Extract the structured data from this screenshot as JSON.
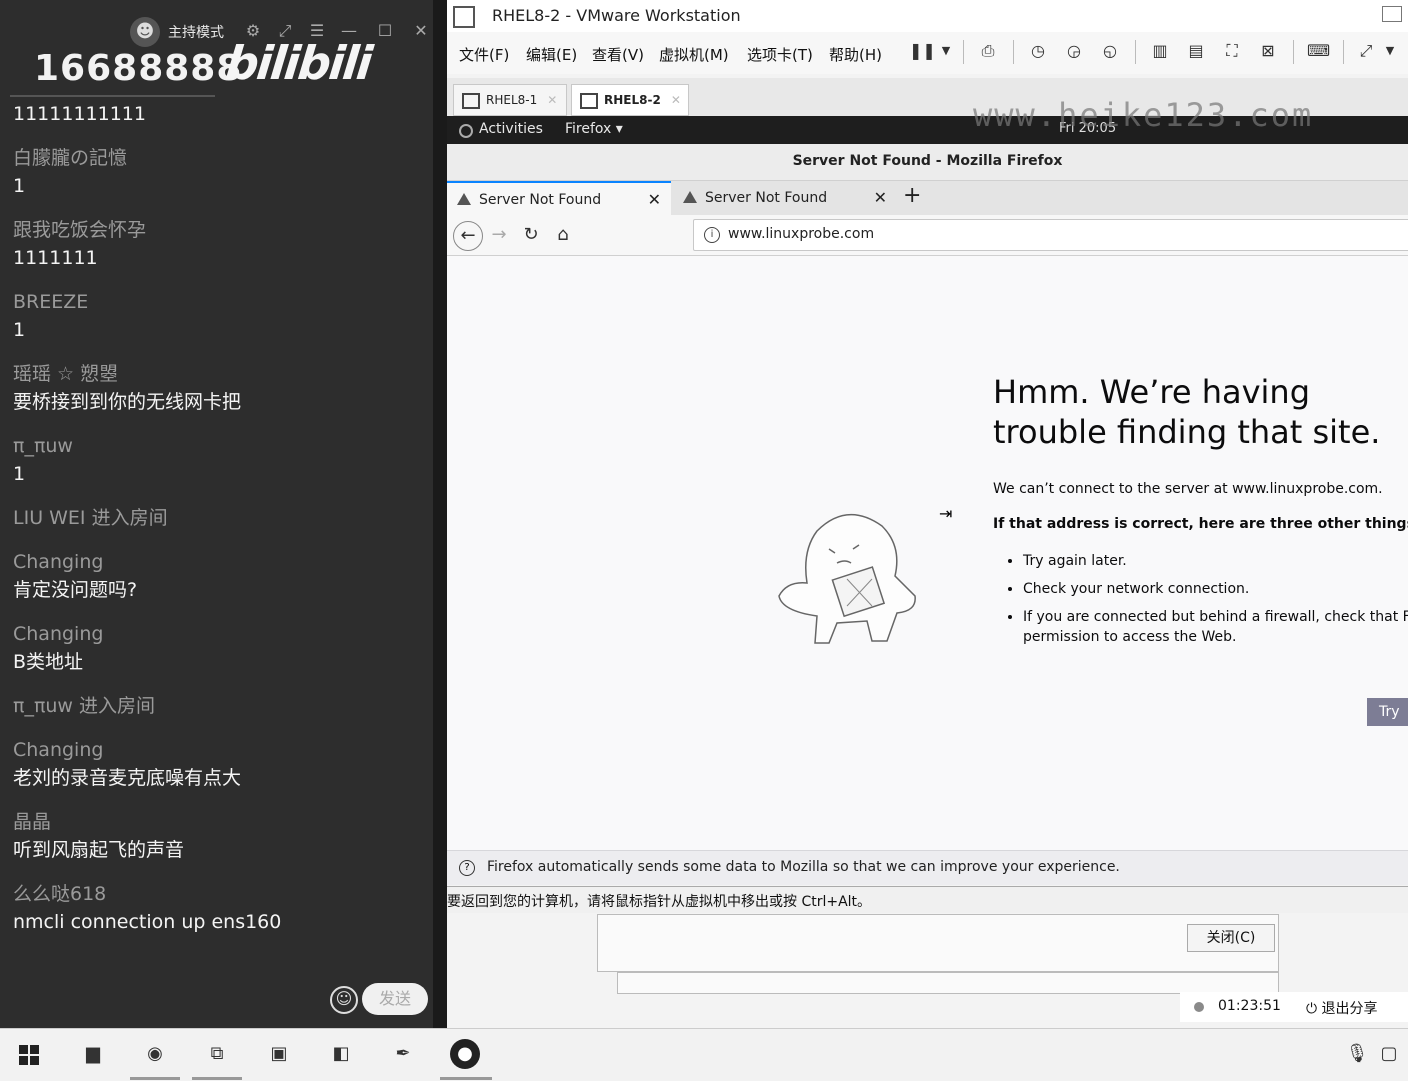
{
  "chat": {
    "host_mode_label": "主持模式",
    "room_id": "16688888",
    "brand_logo": "bilibili",
    "send_label": "发送",
    "messages": [
      {
        "user": "",
        "text": "11111111111"
      },
      {
        "user": "白朦朧の記憶",
        "text": "1"
      },
      {
        "user": "跟我吃饭会怀孕",
        "text": "1111111"
      },
      {
        "user": "BREEZE",
        "text": "1"
      },
      {
        "user": "瑶瑶 ☆ 愬曌",
        "text": "要桥接到到你的无线网卡把"
      },
      {
        "user": "π_πuw",
        "text": "1"
      },
      {
        "system": "LIU WEI 进入房间"
      },
      {
        "user": "Changing",
        "text": "肯定没问题吗?"
      },
      {
        "user": "Changing",
        "text": "B类地址"
      },
      {
        "system": "π_πuw 进入房间"
      },
      {
        "user": "Changing",
        "text": "老刘的录音麦克底噪有点大"
      },
      {
        "user": "晶晶",
        "text": "听到风扇起飞的声音"
      },
      {
        "user": "么么哒618",
        "text": "nmcli connection up ens160"
      }
    ]
  },
  "vmware": {
    "title": "RHEL8-2 - VMware Workstation",
    "menu": [
      "文件(F)",
      "编辑(E)",
      "查看(V)",
      "虚拟机(M)",
      "选项卡(T)",
      "帮助(H)"
    ],
    "tabs": [
      {
        "label": "RHEL8-1",
        "active": false
      },
      {
        "label": "RHEL8-2",
        "active": true
      }
    ],
    "status_hint": "要返回到您的计算机，请将鼠标指针从虚拟机中移出或按 Ctrl+Alt。",
    "close_dialog_label": "关闭(C)",
    "share_timer": "01:23:51",
    "share_exit_label": "退出分享"
  },
  "gnome": {
    "activities": "Activities",
    "app_menu": "Firefox ▾",
    "clock": "Fri 20:05",
    "watermark": "www.heike123.com"
  },
  "firefox": {
    "window_title": "Server Not Found - Mozilla Firefox",
    "tabs": [
      "Server Not Found",
      "Server Not Found"
    ],
    "url": "www.linuxprobe.com",
    "error": {
      "title": "Hmm. We’re having trouble finding that site.",
      "p1": "We can’t connect to the server at www.linuxprobe.com.",
      "p2": "If that address is correct, here are three other things you c",
      "items": [
        "Try again later.",
        "Check your network connection.",
        "If you are connected but behind a firewall, check that Firefo",
        "permission to access the Web."
      ],
      "try_button": "Try"
    },
    "notice": "Firefox automatically sends some data to Mozilla so that we can improve your experience."
  },
  "colors": {
    "chat_bg": "#2d2d2d",
    "ff_accent": "#0a84ff",
    "try_button": "#7d7d95"
  }
}
